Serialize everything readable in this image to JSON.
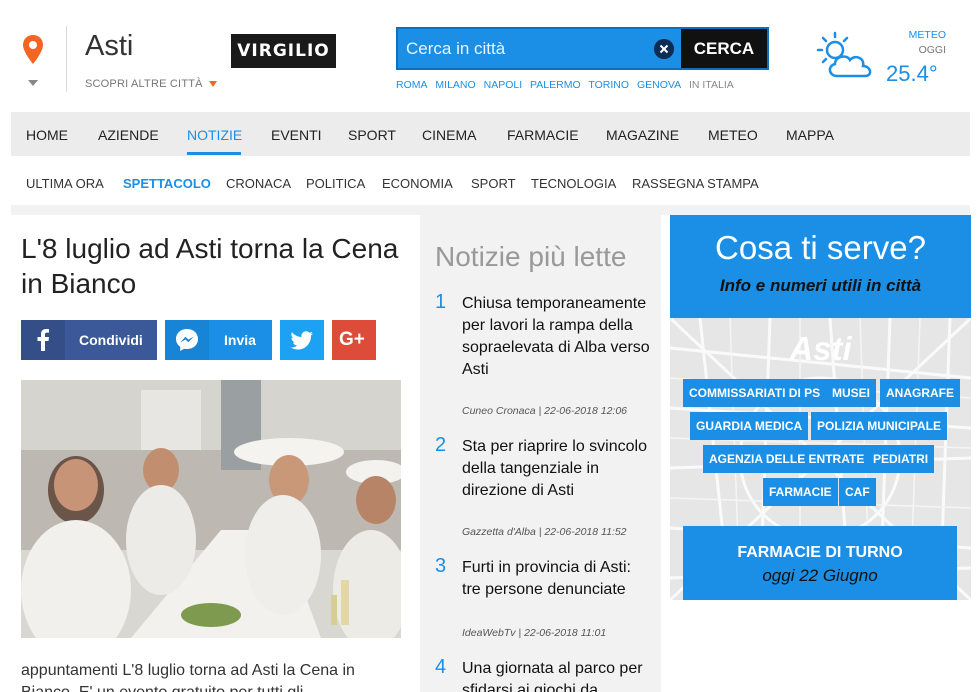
{
  "header": {
    "city": "Asti",
    "other_cities": "SCOPRI ALTRE CITTÀ",
    "logo": "VIRGILIO",
    "search": {
      "placeholder": "Cerca in città",
      "button": "CERCA"
    },
    "quick_links": [
      "ROMA",
      "MILANO",
      "NAPOLI",
      "PALERMO",
      "TORINO",
      "GENOVA",
      "IN ITALIA"
    ],
    "weather": {
      "label": "METEO",
      "sub": "OGGI",
      "temp": "25.4°",
      "icon": "partly-cloudy-icon"
    }
  },
  "main_nav": [
    "HOME",
    "AZIENDE",
    "NOTIZIE",
    "EVENTI",
    "SPORT",
    "CINEMA",
    "FARMACIE",
    "MAGAZINE",
    "METEO",
    "MAPPA"
  ],
  "main_nav_active": "NOTIZIE",
  "sub_nav": [
    "ULTIMA ORA",
    "SPETTACOLO",
    "CRONACA",
    "POLITICA",
    "ECONOMIA",
    "SPORT",
    "TECNOLOGIA",
    "RASSEGNA STAMPA"
  ],
  "sub_nav_active": "SPETTACOLO",
  "article": {
    "title": "L'8 luglio ad Asti torna la Cena in Bianco",
    "share": {
      "facebook": "Condividi",
      "messenger": "Invia",
      "twitter": "twitter-icon",
      "google": "G+"
    },
    "lead": "appuntamenti L'8 luglio torna ad Asti la Cena in Bianco. E' un evento gratuito per tutti gli"
  },
  "most_read": {
    "title": "Notizie più lette",
    "items": [
      {
        "num": "1",
        "title": "Chiusa temporaneamente per lavori la rampa della sopraelevata di Alba verso Asti",
        "source": "Cuneo Cronaca",
        "date": "22-06-2018 12:06"
      },
      {
        "num": "2",
        "title": "Sta per riaprire lo svincolo della tangenziale in direzione di Asti",
        "source": "Gazzetta d'Alba",
        "date": "22-06-2018 11:52"
      },
      {
        "num": "3",
        "title": "Furti in provincia di Asti: tre persone denunciate",
        "source": "IdeaWebTv",
        "date": "22-06-2018 11:01"
      },
      {
        "num": "4",
        "title": "Una giornata al parco per sfidarsi ai giochi da",
        "source": "",
        "date": ""
      }
    ]
  },
  "services": {
    "title": "Cosa ti serve?",
    "subtitle": "Info e numeri utili in città",
    "city": "Asti",
    "tags": [
      "COMMISSARIATI DI PS",
      "MUSEI",
      "ANAGRAFE",
      "GUARDIA MEDICA",
      "POLIZIA MUNICIPALE",
      "AGENZIA DELLE ENTRATE",
      "PEDIATRI",
      "FARMACIE",
      "CAF"
    ],
    "pharmacies": {
      "title": "FARMACIE DI TURNO",
      "date": "oggi 22 Giugno"
    }
  },
  "colors": {
    "accent": "#1a8fe5",
    "nav_bg": "#ececec",
    "panel_bg": "#f2f2f2",
    "pin": "#f26522"
  }
}
